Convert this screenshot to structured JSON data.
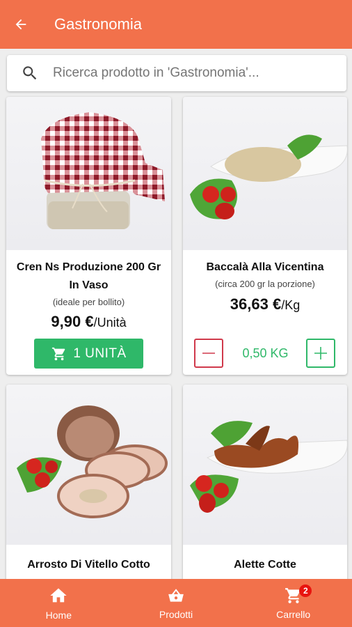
{
  "app_bar": {
    "title": "Gastronomia",
    "back_icon": "arrow-left-icon"
  },
  "search": {
    "placeholder": "Ricerca prodotto in 'Gastronomia'..."
  },
  "products": [
    {
      "name_line1": "Cren Ns Produzione 200 Gr",
      "name_line2": "In Vaso",
      "note": "(ideale per bollito)",
      "price": "9,90 €",
      "unit": "/Unità",
      "action": "1 UNITÀ"
    },
    {
      "name_line1": "Baccalà Alla Vicentina",
      "note": "(circa 200 gr la porzione)",
      "price": "36,63 €",
      "unit": "/Kg",
      "quantity": "0,50 KG"
    },
    {
      "name_line1": "Arrosto Di Vitello Cotto",
      "note": ""
    },
    {
      "name_line1": "Alette Cotte",
      "note": ""
    }
  ],
  "bottom_nav": {
    "items": [
      {
        "label": "Home",
        "icon": "home-icon"
      },
      {
        "label": "Prodotti",
        "icon": "basket-icon"
      },
      {
        "label": "Carrello",
        "icon": "cart-icon",
        "badge": "2"
      }
    ]
  },
  "colors": {
    "primary": "#f2714b",
    "green": "#2fb869",
    "red": "#d0394b",
    "badge": "#e8150f"
  }
}
